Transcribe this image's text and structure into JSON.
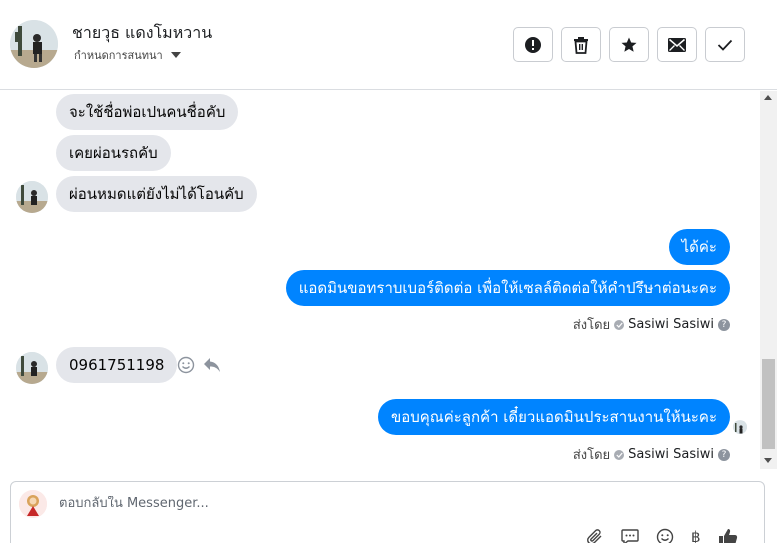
{
  "header": {
    "contact_name": "ชายวุธ แดงโมหวาน",
    "sub_label": "กำหนดการสนทนา",
    "actions": [
      "report-icon",
      "trash-icon",
      "star-icon",
      "envelope-icon",
      "check-icon"
    ]
  },
  "thread": {
    "messages": [
      {
        "from": "contact",
        "text": "จะใช้ชื่อพ่อเปนคนชื่อคับ"
      },
      {
        "from": "contact",
        "text": "เคยผ่อนรถคับ"
      },
      {
        "from": "contact",
        "text": "ผ่อนหมดแต่ยังไม่ได้โอนคับ"
      },
      {
        "from": "page",
        "text": "ได้ค่ะ"
      },
      {
        "from": "page",
        "text": "แอดมินขอทราบเบอร์ติดต่อ เพื่อให้เซลล์ติดต่อให้คำปรึษาต่อนะคะ"
      },
      {
        "from": "contact",
        "text": "0961751198"
      },
      {
        "from": "page",
        "text": "ขอบคุณค่ะลูกค้า เดี๋ยวแอดมินประสานงานให้นะคะ"
      }
    ],
    "sent_by_label": "ส่งโดย",
    "sent_by_name": "Sasiwi Sasiwi",
    "info_glyph": "?"
  },
  "composer": {
    "placeholder": "ตอบกลับใน Messenger...",
    "tools": [
      "attachment-icon",
      "saved-replies-icon",
      "emoji-icon",
      "baht-icon",
      "like-icon"
    ],
    "baht_glyph": "฿"
  },
  "colors": {
    "outgoing": "#0084ff",
    "incoming": "#e4e6eb",
    "border": "#dadde1"
  }
}
